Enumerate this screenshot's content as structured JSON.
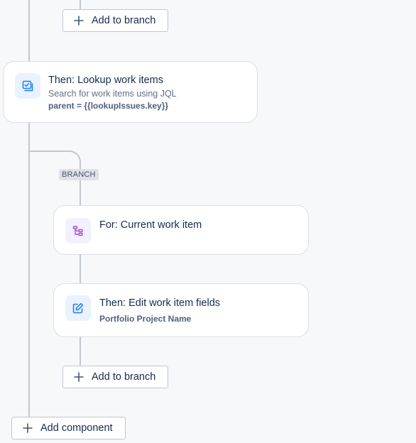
{
  "top_branch_button": {
    "label": "Add to branch"
  },
  "lookup_card": {
    "title": "Then: Lookup work items",
    "subtitle": "Search for work items using JQL",
    "detail": "parent = {{lookupIssues.key}}",
    "icon": "checklist-icon"
  },
  "branch_label": "BRANCH",
  "for_card": {
    "title": "For: Current work item",
    "icon": "branch-tree-icon"
  },
  "edit_card": {
    "title": "Then: Edit work item fields",
    "detail": "Portfolio Project Name",
    "icon": "edit-icon"
  },
  "bottom_branch_button": {
    "label": "Add to branch"
  },
  "add_component_button": {
    "label": "Add component"
  },
  "colors": {
    "connector": "#c1c7d0",
    "icon_blue_bg": "#e9f2ff",
    "icon_blue": "#1d7afc",
    "icon_purple_bg": "#f3f0ff",
    "icon_purple": "#a54fcf"
  }
}
